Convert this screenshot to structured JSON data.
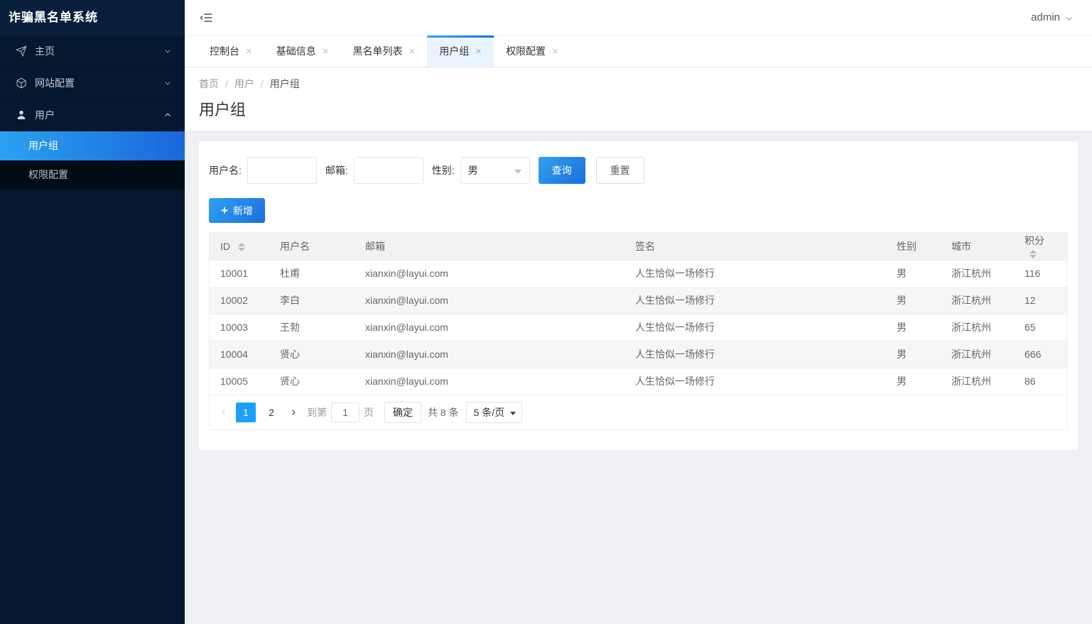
{
  "app": {
    "title": "诈骗黑名单系统"
  },
  "topbar": {
    "username": "admin"
  },
  "sidebar": {
    "items": [
      {
        "label": "主页"
      },
      {
        "label": "网站配置"
      },
      {
        "label": "用户"
      }
    ],
    "submenu": [
      {
        "label": "用户组",
        "active": true
      },
      {
        "label": "权限配置",
        "active": false
      }
    ]
  },
  "tabs": [
    {
      "label": "控制台"
    },
    {
      "label": "基础信息"
    },
    {
      "label": "黑名单列表"
    },
    {
      "label": "用户组"
    },
    {
      "label": "权限配置"
    }
  ],
  "breadcrumb": {
    "items": [
      "首页",
      "用户",
      "用户组"
    ],
    "separator": "/"
  },
  "page": {
    "title": "用户组"
  },
  "search": {
    "username_label": "用户名:",
    "email_label": "邮箱:",
    "gender_label": "性别:",
    "gender_value": "男",
    "search_button": "查询",
    "reset_button": "重置"
  },
  "toolbar": {
    "add_button": "新增"
  },
  "icons": {
    "close": "×",
    "plus": "+"
  },
  "table": {
    "columns": [
      "ID",
      "用户名",
      "邮箱",
      "签名",
      "性别",
      "城市",
      "积分"
    ],
    "rows": [
      {
        "id": "10001",
        "username": "杜甫",
        "email": "xianxin@layui.com",
        "sign": "人生恰似一场修行",
        "sex": "男",
        "city": "浙江杭州",
        "score": "116"
      },
      {
        "id": "10002",
        "username": "李白",
        "email": "xianxin@layui.com",
        "sign": "人生恰似一场修行",
        "sex": "男",
        "city": "浙江杭州",
        "score": "12"
      },
      {
        "id": "10003",
        "username": "王勃",
        "email": "xianxin@layui.com",
        "sign": "人生恰似一场修行",
        "sex": "男",
        "city": "浙江杭州",
        "score": "65"
      },
      {
        "id": "10004",
        "username": "贤心",
        "email": "xianxin@layui.com",
        "sign": "人生恰似一场修行",
        "sex": "男",
        "city": "浙江杭州",
        "score": "666"
      },
      {
        "id": "10005",
        "username": "贤心",
        "email": "xianxin@layui.com",
        "sign": "人生恰似一场修行",
        "sex": "男",
        "city": "浙江杭州",
        "score": "86"
      }
    ]
  },
  "pagination": {
    "pages": [
      "1",
      "2"
    ],
    "current_page": "1",
    "goto_label": "到第",
    "goto_value": "1",
    "page_unit": "页",
    "confirm_button": "确定",
    "total_text": "共 8 条",
    "per_page_value": "5 条/页"
  },
  "colors": {
    "accent": "#1e9fff",
    "button_gradient_start": "#30a2f2",
    "button_gradient_end": "#1a6edb",
    "sidebar_bg": "#041830",
    "submenu_bg": "#030b16",
    "active_menu_gradient_start": "#2ba2f1",
    "active_menu_gradient_end": "#1a66d9"
  }
}
